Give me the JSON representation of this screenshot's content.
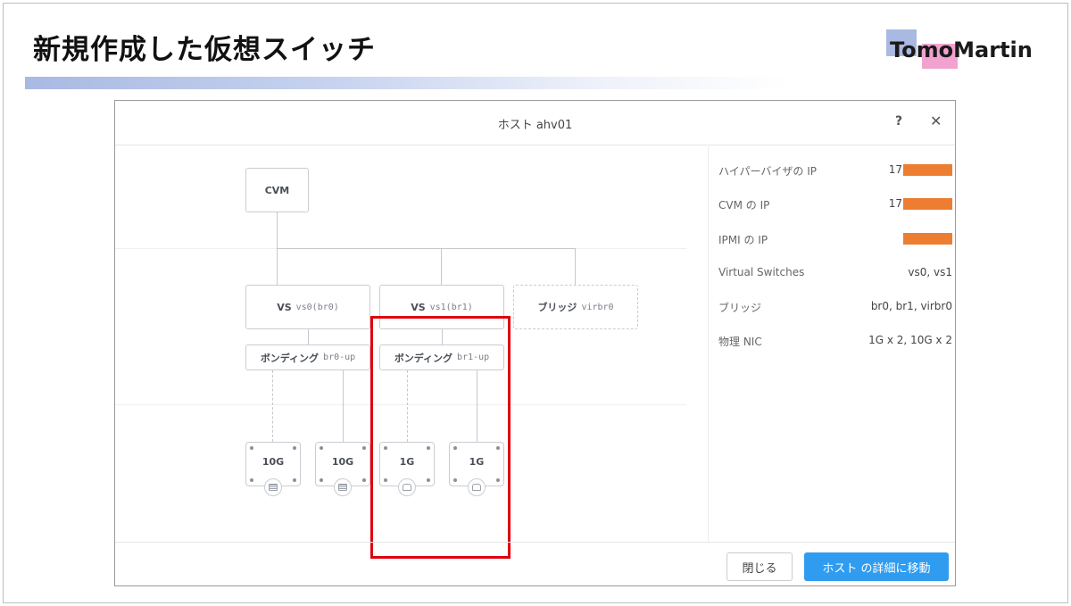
{
  "slide": {
    "title": "新規作成した仮想スイッチ",
    "logo": {
      "part1": "Tomo",
      "part2": "Martin"
    },
    "colors": {
      "title_bar": "#a9b9e2",
      "logo_blue": "#a9b9e2",
      "logo_pink": "#f2a2cf",
      "highlight": "#e0000e"
    }
  },
  "dialog": {
    "title": "ホスト ahv01",
    "help_label": "?",
    "close_label": "✕",
    "diagram": {
      "cvm": "CVM",
      "vs0": {
        "prefix": "VS",
        "name": "vs0(br0)"
      },
      "vs1": {
        "prefix": "VS",
        "name": "vs1(br1)"
      },
      "bridge": {
        "prefix": "ブリッジ",
        "name": "virbr0"
      },
      "bond0": {
        "prefix": "ボンディング",
        "name": "br0-up"
      },
      "bond1": {
        "prefix": "ボンディング",
        "name": "br1-up"
      },
      "ports": [
        {
          "label": "10G",
          "icon": "sfp-port-icon"
        },
        {
          "label": "10G",
          "icon": "sfp-port-icon"
        },
        {
          "label": "1G",
          "icon": "ethernet-port-icon"
        },
        {
          "label": "1G",
          "icon": "ethernet-port-icon"
        }
      ]
    },
    "properties": [
      {
        "label": "ハイパーバイザの IP",
        "value": "17",
        "redacted": true
      },
      {
        "label": "CVM の IP",
        "value": "17",
        "redacted": true
      },
      {
        "label": "IPMI の IP",
        "value": "",
        "redacted": true
      },
      {
        "label": "Virtual Switches",
        "value": "vs0, vs1",
        "redacted": false
      },
      {
        "label": "ブリッジ",
        "value": "br0, br1, virbr0",
        "redacted": false
      },
      {
        "label": "物理 NIC",
        "value": "1G x 2, 10G x 2",
        "redacted": false
      }
    ],
    "buttons": {
      "close": "閉じる",
      "go_to_details": "ホスト の詳細に移動"
    }
  }
}
